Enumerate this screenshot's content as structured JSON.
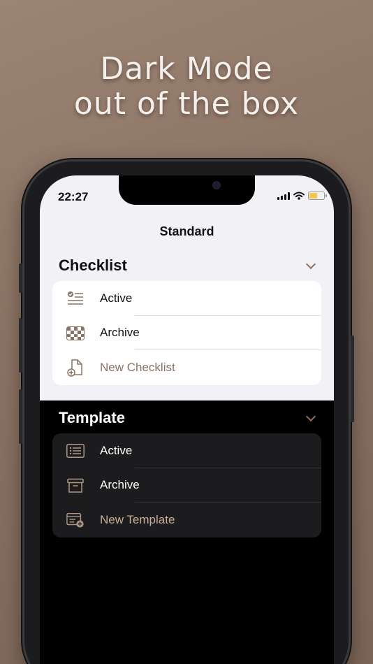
{
  "headline": {
    "line1": "Dark Mode",
    "line2": "out of the box"
  },
  "status_bar": {
    "time": "22:27"
  },
  "navigation": {
    "title": "Standard"
  },
  "colors": {
    "accent": "#8a7263",
    "light_bg": "#f2f1f5",
    "dark_card": "#1c1c1e",
    "battery": "#f2c94c"
  },
  "checklist_section": {
    "title": "Checklist",
    "items": [
      {
        "label": "Active",
        "icon": "checklist-icon"
      },
      {
        "label": "Archive",
        "icon": "checkerboard-icon"
      },
      {
        "label": "New Checklist",
        "icon": "new-document-icon"
      }
    ]
  },
  "template_section": {
    "title": "Template",
    "items": [
      {
        "label": "Active",
        "icon": "list-icon"
      },
      {
        "label": "Archive",
        "icon": "archive-box-icon"
      },
      {
        "label": "New Template",
        "icon": "new-template-icon"
      }
    ]
  }
}
